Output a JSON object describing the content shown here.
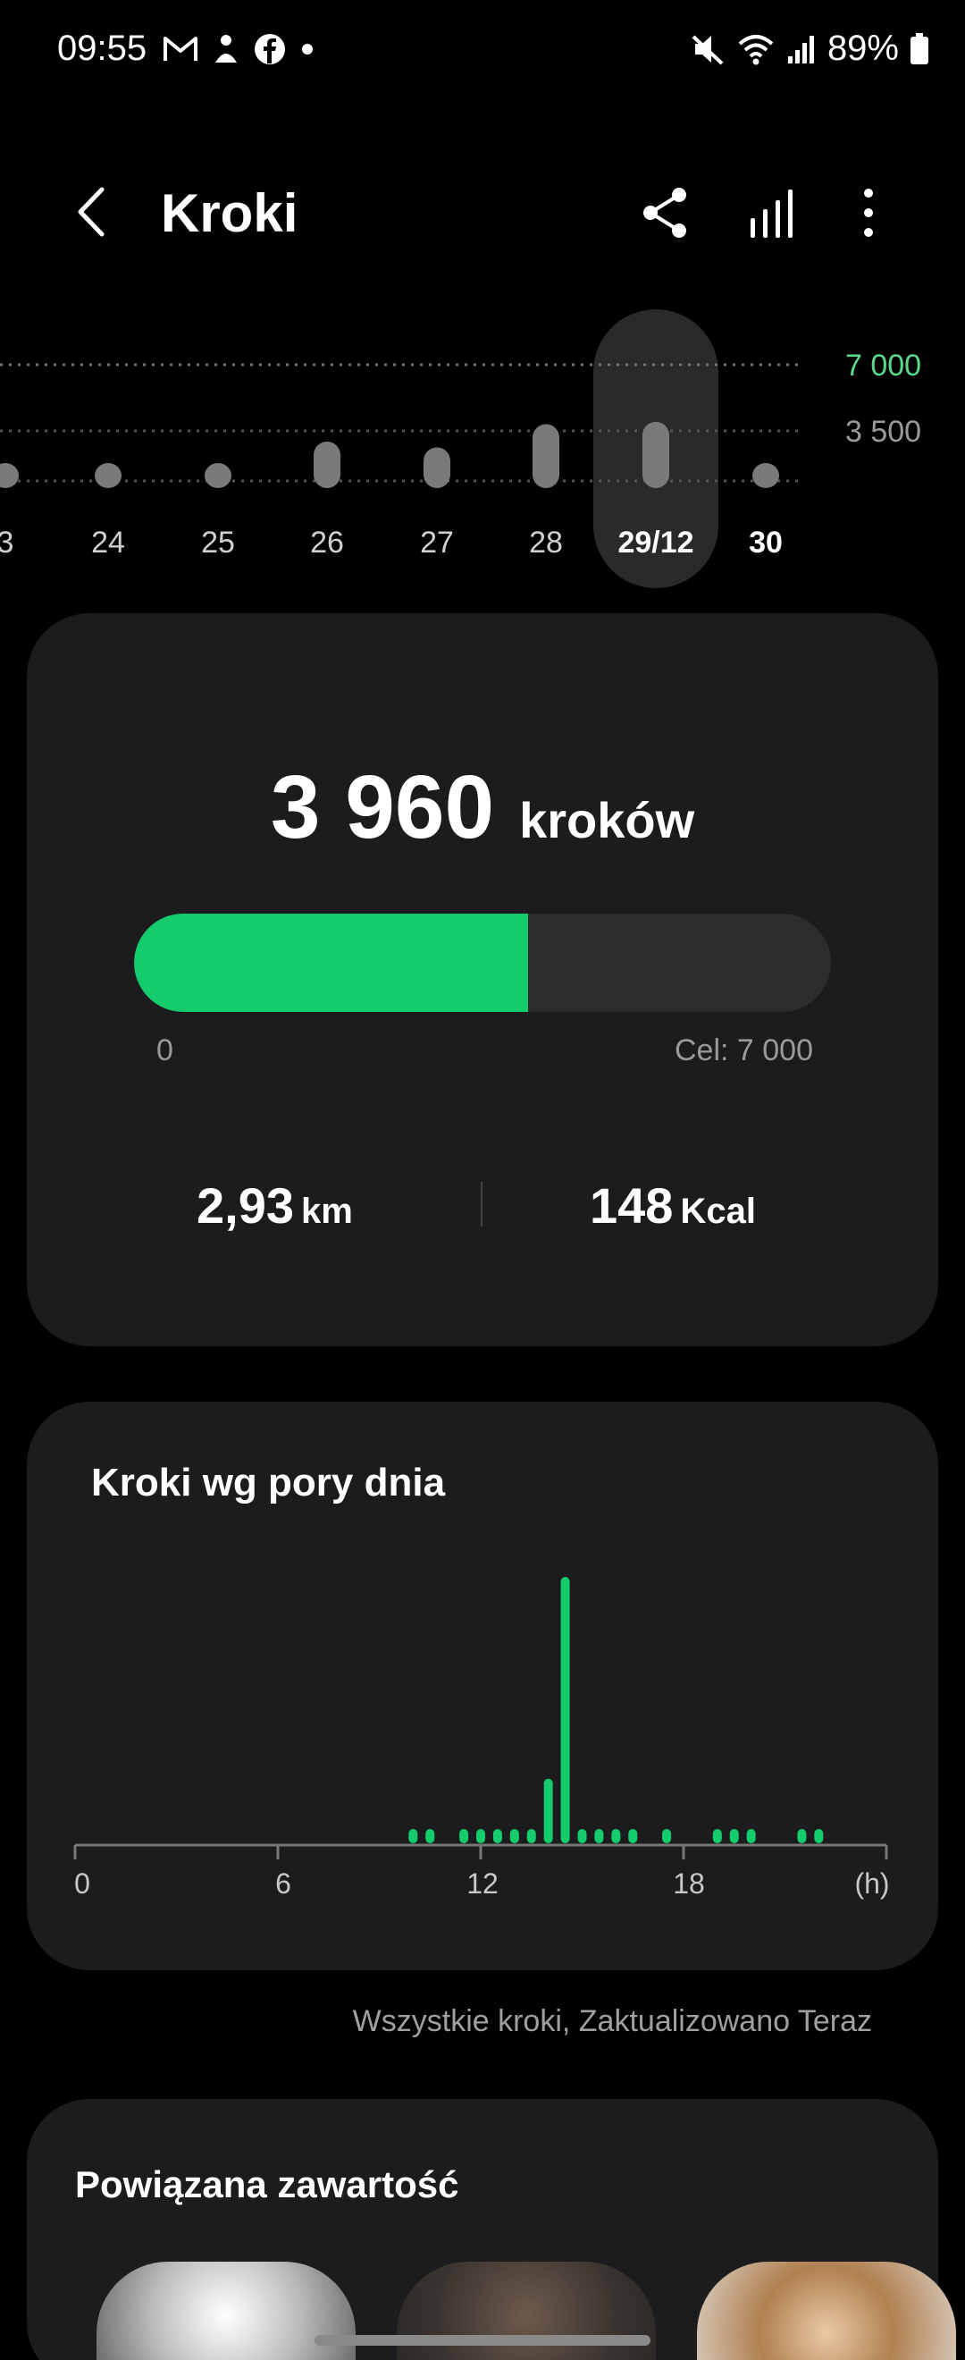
{
  "status_bar": {
    "time": "09:55",
    "notification_icons": [
      "gmail-icon",
      "app-icon",
      "facebook-icon",
      "dot-icon"
    ],
    "battery": "89%"
  },
  "header": {
    "title": "Kroki"
  },
  "week_strip": {
    "days": [
      "3",
      "24",
      "25",
      "26",
      "27",
      "28",
      "29/12",
      "30"
    ],
    "selected": "29/12",
    "goal_label": "7 000",
    "half_label": "3 500",
    "steps_fraction_of_goal": [
      0.0,
      0.1,
      0.05,
      0.4,
      0.35,
      0.55,
      0.57,
      0.05
    ]
  },
  "summary": {
    "steps": "3 960",
    "steps_unit": "kroków",
    "progress_fraction": 0.566,
    "progress_min": "0",
    "progress_goal": "Cel: 7 000",
    "distance_value": "2,93",
    "distance_unit": "km",
    "calories_value": "148",
    "calories_unit": "Kcal"
  },
  "hourly": {
    "title": "Kroki wg pory dnia",
    "x_ticks": [
      "0",
      "6",
      "12",
      "18",
      "(h)"
    ]
  },
  "chart_data": {
    "type": "bar",
    "title": "Kroki wg pory dnia",
    "xlabel": "(h)",
    "ylabel": "",
    "xlim": [
      0,
      24
    ],
    "x": [
      10,
      10.5,
      11.5,
      12,
      12.5,
      13,
      13.5,
      14,
      14.5,
      15,
      15.5,
      16,
      16.5,
      17.5,
      19,
      19.5,
      20,
      21.5,
      22
    ],
    "values": [
      40,
      40,
      40,
      40,
      40,
      80,
      40,
      400,
      1650,
      40,
      80,
      40,
      40,
      40,
      40,
      40,
      40,
      60,
      40
    ]
  },
  "footnote": "Wszystkie kroki, Zaktualizowano Teraz",
  "related": {
    "title": "Powiązana zawartość"
  },
  "colors": {
    "accent": "#14cc6c",
    "card": "#1c1c1e",
    "background": "#000000"
  }
}
